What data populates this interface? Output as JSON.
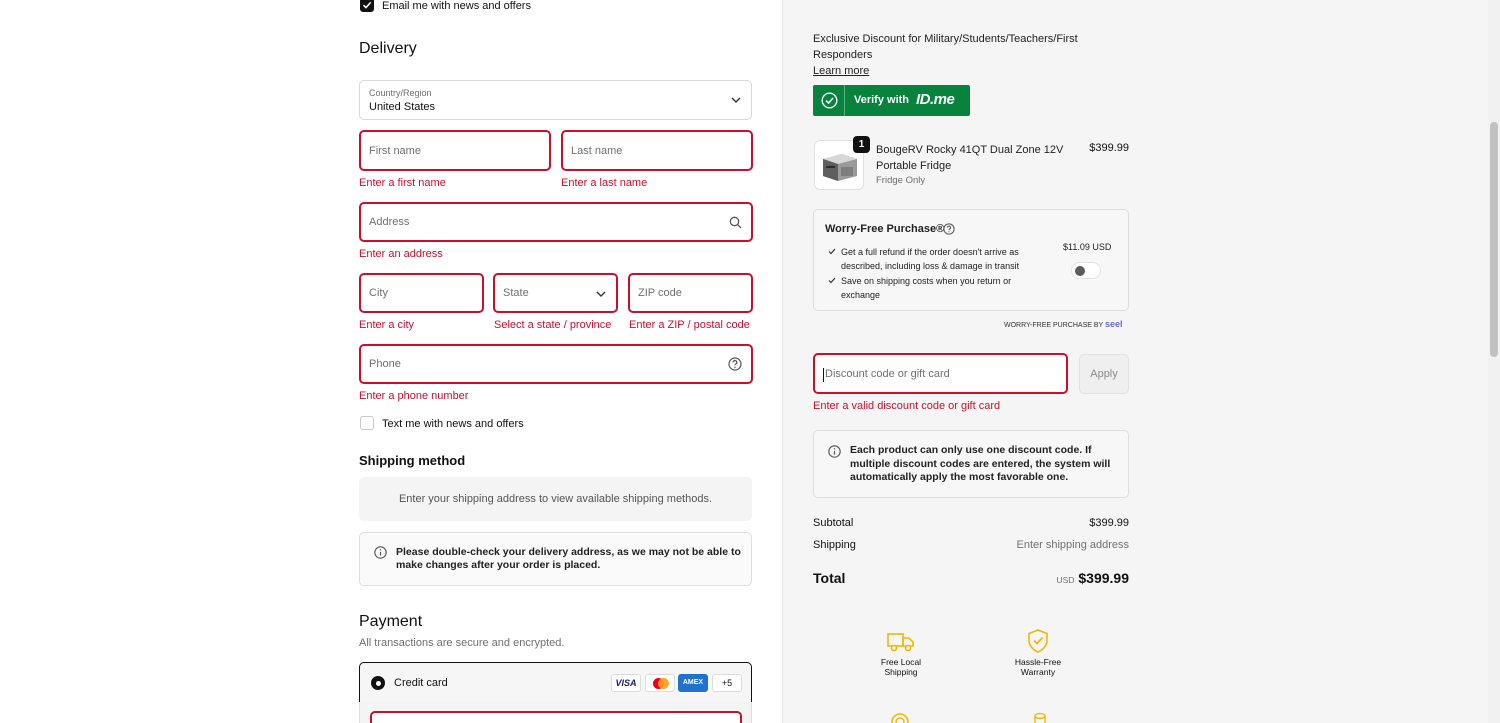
{
  "contact": {
    "email_opt_in_label": "Email me with news and offers"
  },
  "delivery": {
    "title": "Delivery",
    "country_label": "Country/Region",
    "country_value": "United States",
    "first_name_placeholder": "First name",
    "first_name_error": "Enter a first name",
    "last_name_placeholder": "Last name",
    "last_name_error": "Enter a last name",
    "address_placeholder": "Address",
    "address_error": "Enter an address",
    "city_placeholder": "City",
    "city_error": "Enter a city",
    "state_placeholder": "State",
    "state_error": "Select a state / province",
    "zip_placeholder": "ZIP code",
    "zip_error": "Enter a ZIP / postal code",
    "phone_placeholder": "Phone",
    "phone_error": "Enter a phone number",
    "sms_opt_in_label": "Text me with news and offers"
  },
  "shipping": {
    "title": "Shipping method",
    "empty_message": "Enter your shipping address to view available shipping methods.",
    "notice": "Please double-check your delivery address, as we may not be able to make changes after your order is placed."
  },
  "payment": {
    "title": "Payment",
    "subtitle": "All transactions are secure and encrypted.",
    "credit_card_label": "Credit card",
    "card_brands": [
      "VISA",
      "AMEX"
    ],
    "more_brands": "+5"
  },
  "summary": {
    "discount_promo": "Exclusive Discount for Military/Students/Teachers/First Responders",
    "learn_more": "Learn more",
    "verify_label": "Verify with",
    "verify_brand": "ID.me",
    "product": {
      "quantity": "1",
      "name": "BougeRV Rocky 41QT Dual Zone 12V Portable Fridge",
      "variant": "Fridge Only",
      "price": "$399.99"
    },
    "worry_free": {
      "title": "Worry-Free Purchase®",
      "benefit_1": "Get a full refund if the order doesn't arrive as described, including loss & damage in transit",
      "benefit_2": "Save on shipping costs when you return or exchange",
      "price": "$11.09 USD",
      "footer_label": "WORRY-FREE PURCHASE BY",
      "footer_brand": "seel"
    },
    "discount": {
      "placeholder": "Discount code or gift card",
      "apply_label": "Apply",
      "error": "Enter a valid discount code or gift card",
      "info": "Each product can only use one discount code. If multiple discount codes are entered, the system will automatically apply the most favorable one."
    },
    "totals": {
      "subtotal_label": "Subtotal",
      "subtotal_value": "$399.99",
      "shipping_label": "Shipping",
      "shipping_value": "Enter shipping address",
      "total_label": "Total",
      "currency": "USD",
      "total_value": "$399.99"
    },
    "features": {
      "free_shipping": "Free Local Shipping",
      "warranty": "Hassle-Free Warranty"
    }
  },
  "colors": {
    "error": "#c8102e",
    "idme_green": "#08833d",
    "accent_yellow": "#f2b705"
  }
}
